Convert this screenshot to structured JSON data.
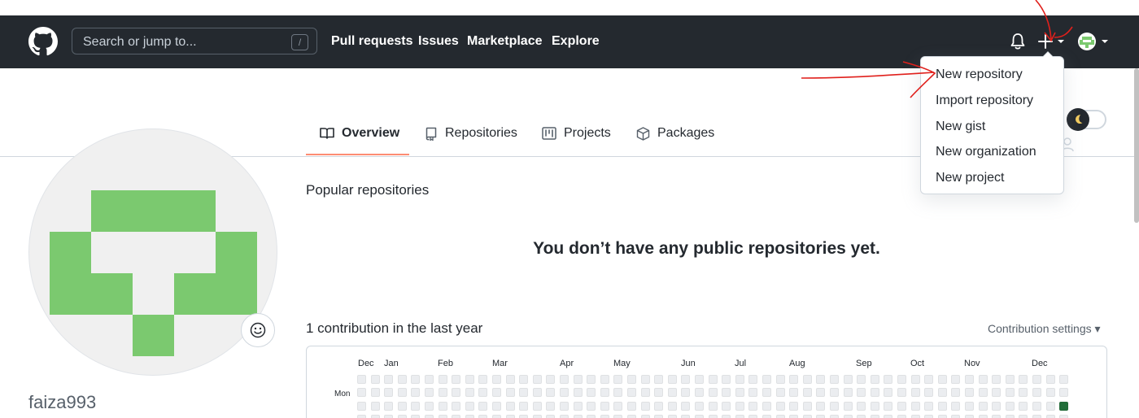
{
  "header": {
    "search_placeholder": "Search or jump to...",
    "search_shortcut": "/",
    "nav": [
      "Pull requests",
      "Issues",
      "Marketplace",
      "Explore"
    ]
  },
  "dropdown": {
    "items": [
      "New repository",
      "Import repository",
      "New gist",
      "New organization",
      "New project"
    ]
  },
  "tabs": [
    "Overview",
    "Repositories",
    "Projects",
    "Packages"
  ],
  "profile": {
    "username": "faiza993"
  },
  "main": {
    "popular_title": "Popular repositories",
    "empty_message": "You don’t have any public repositories yet.",
    "contributions_title": "1 contribution in the last year",
    "contribution_settings": "Contribution settings ▾"
  },
  "graph": {
    "months": [
      "Dec",
      "Jan",
      "Feb",
      "Mar",
      "Apr",
      "May",
      "Jun",
      "Jul",
      "Aug",
      "Sep",
      "Oct",
      "Nov",
      "Dec"
    ],
    "day_label": "Mon",
    "highlight_color": "#216e39",
    "empty_color": "#ebedf0"
  },
  "colors": {
    "header_bg": "#24292f",
    "tab_underline": "#fd8c73",
    "identicon": "#7bc96f",
    "annotation": "#e0201c"
  }
}
